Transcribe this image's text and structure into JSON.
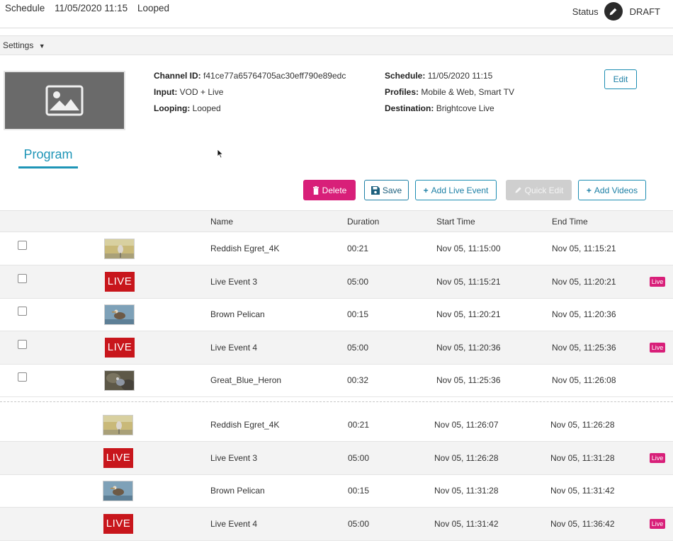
{
  "header": {
    "schedule_label": "Schedule",
    "schedule_datetime": "11/05/2020 11:15",
    "looping": "Looped",
    "status_label": "Status",
    "status_value": "DRAFT"
  },
  "settings": {
    "label": "Settings",
    "caret": "▼"
  },
  "details": {
    "channel_id_label": "Channel ID:",
    "channel_id": "f41ce77a65764705ac30eff790e89edc",
    "input_label": "Input:",
    "input": "VOD + Live",
    "looping_label": "Looping:",
    "looping": "Looped",
    "schedule_label": "Schedule:",
    "schedule": "11/05/2020 11:15",
    "profiles_label": "Profiles:",
    "profiles": "Mobile & Web, Smart TV",
    "destination_label": "Destination:",
    "destination": "Brightcove Live",
    "edit_label": "Edit"
  },
  "tabs": {
    "program": "Program"
  },
  "toolbar": {
    "delete": "Delete",
    "save": "Save",
    "add_live_event": "Add Live Event",
    "quick_edit": "Quick Edit",
    "add_videos": "Add Videos"
  },
  "table": {
    "headers": [
      "Name",
      "Duration",
      "Start Time",
      "End Time"
    ],
    "live_text": "LIVE",
    "live_badge": "Live",
    "rows": [
      {
        "type": "video",
        "thumb": "egret",
        "name": "Reddish Egret_4K",
        "duration": "00:21",
        "start": "Nov 05, 11:15:00",
        "end": "Nov 05, 11:15:21",
        "checkbox": true
      },
      {
        "type": "live",
        "name": "Live Event 3",
        "duration": "05:00",
        "start": "Nov 05, 11:15:21",
        "end": "Nov 05, 11:20:21",
        "checkbox": true
      },
      {
        "type": "video",
        "thumb": "pelican",
        "name": "Brown Pelican",
        "duration": "00:15",
        "start": "Nov 05, 11:20:21",
        "end": "Nov 05, 11:20:36",
        "checkbox": true
      },
      {
        "type": "live",
        "name": "Live Event 4",
        "duration": "05:00",
        "start": "Nov 05, 11:20:36",
        "end": "Nov 05, 11:25:36",
        "checkbox": true
      },
      {
        "type": "video",
        "thumb": "heron",
        "name": "Great_Blue_Heron",
        "duration": "00:32",
        "start": "Nov 05, 11:25:36",
        "end": "Nov 05, 11:26:08",
        "checkbox": true
      }
    ],
    "loop_rows": [
      {
        "type": "video",
        "thumb": "egret",
        "name": "Reddish Egret_4K",
        "duration": "00:21",
        "start": "Nov 05, 11:26:07",
        "end": "Nov 05, 11:26:28"
      },
      {
        "type": "live",
        "name": "Live Event 3",
        "duration": "05:00",
        "start": "Nov 05, 11:26:28",
        "end": "Nov 05, 11:31:28"
      },
      {
        "type": "video",
        "thumb": "pelican",
        "name": "Brown Pelican",
        "duration": "00:15",
        "start": "Nov 05, 11:31:28",
        "end": "Nov 05, 11:31:42"
      },
      {
        "type": "live",
        "name": "Live Event 4",
        "duration": "05:00",
        "start": "Nov 05, 11:31:42",
        "end": "Nov 05, 11:36:42"
      }
    ]
  }
}
